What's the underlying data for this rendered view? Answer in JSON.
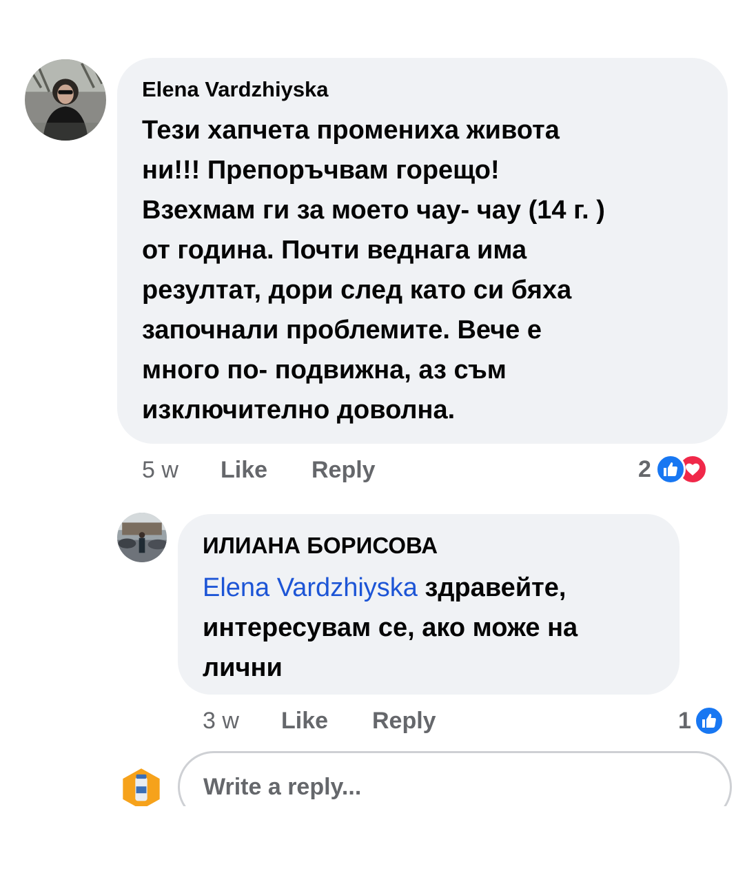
{
  "comments": [
    {
      "author": "Elena Vardzhiyska",
      "lines": [
        "Тези хапчета промениха живота",
        "ни!!! Препоръчвам горещо!",
        "Взехмам ги за моето чау- чау (14 г. )",
        "от година. Почти веднага има",
        "резултат, дори след като си бяха",
        "започнали проблемите. Вече е",
        "много по- подвижна, аз съм",
        "изключително доволна."
      ],
      "time": "5 w",
      "like_label": "Like",
      "reply_label": "Reply",
      "reaction_count": "2",
      "reactions": [
        "like-icon",
        "love-icon"
      ]
    },
    {
      "author": "ИЛИАНА БОРИСОВА",
      "mention": "Elena Vardzhiyska",
      "line1_rest": " здравейте,",
      "lines": [
        "интересувам се, ако може на",
        "лични"
      ],
      "time": "3 w",
      "like_label": "Like",
      "reply_label": "Reply",
      "reaction_count": "1",
      "reactions": [
        "like-icon"
      ]
    }
  ],
  "reply": {
    "placeholder": "Write a reply..."
  },
  "colors": {
    "bubble": "#f0f2f5",
    "mention": "#1d55d6",
    "like": "#1877f2",
    "love": "#f02849",
    "meta": "#65676b"
  }
}
